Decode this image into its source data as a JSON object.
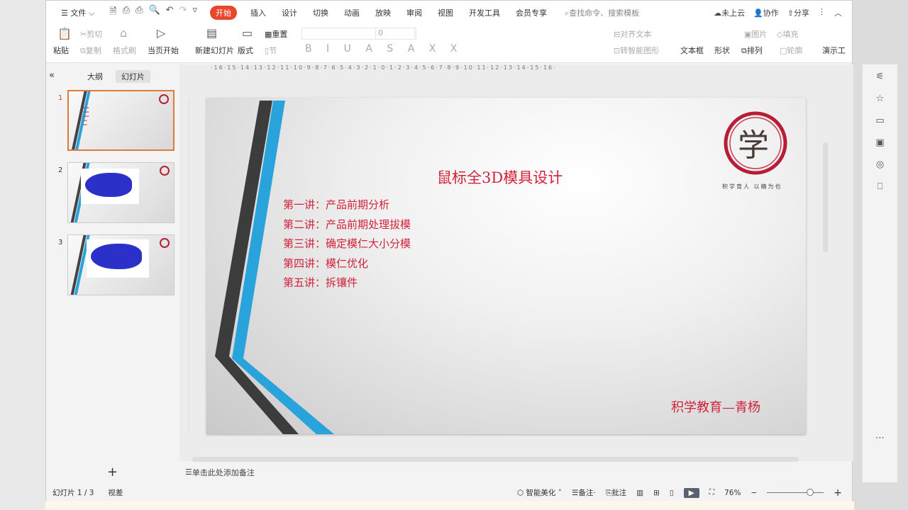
{
  "menu": {
    "file": "文件",
    "tabs": [
      "开始",
      "插入",
      "设计",
      "切换",
      "动画",
      "放映",
      "审阅",
      "视图",
      "开发工具",
      "会员专享"
    ],
    "search": "查找命令、搜索模板",
    "cloud": "未上云",
    "collab": "协作",
    "share": "分享"
  },
  "toolbar": {
    "paste": "粘贴",
    "cut": "剪切",
    "copy": "复制",
    "format_painter": "格式刷",
    "play_from_current": "当页开始",
    "new_slide": "新建幻灯片",
    "layout": "版式",
    "section": "节",
    "reset": "重置",
    "font_size": "0",
    "align_text": "对齐文本",
    "smartart": "转智能图形",
    "textbox": "文本框",
    "shape": "形状",
    "arrange": "排列",
    "picture": "图片",
    "fill": "填充",
    "outline": "轮廓",
    "presentation_tools": "演示工"
  },
  "left_panel": {
    "tab_outline": "大纲",
    "tab_slides": "幻灯片",
    "slides": [
      "1",
      "2",
      "3"
    ],
    "selected": 1
  },
  "ruler": "·16·15·14·13·12·11·10·9·8·7·6·5·4·3·2·1·0·1·2·3·4·5·6·7·8·9·10·11·12·13·14·15·16·",
  "slide": {
    "title": "鼠标全3D模具设计",
    "items": [
      "第一讲：产品前期分析",
      "第二讲：产品前期处理拔模",
      "第三讲：确定模仁大小分模",
      " 第四讲：模仁优化",
      " 第五讲：拆镶件"
    ],
    "author": "积学教育—青杨",
    "logo_char": "学",
    "motto": "积学育人  以精为也"
  },
  "notes": {
    "placeholder": "单击此处添加备注"
  },
  "status": {
    "slide_counter": "幻灯片 1 / 3",
    "theme": "视差",
    "smart_beautify": "智能美化",
    "notes": "备注",
    "comments": "批注",
    "zoom": "76%",
    "zoom_value": 76
  },
  "colors": {
    "accent": "#e8472a",
    "slide_text": "#d0223a",
    "blue_stripe": "#29a3dc",
    "dark_stripe": "#3c3c3c"
  }
}
